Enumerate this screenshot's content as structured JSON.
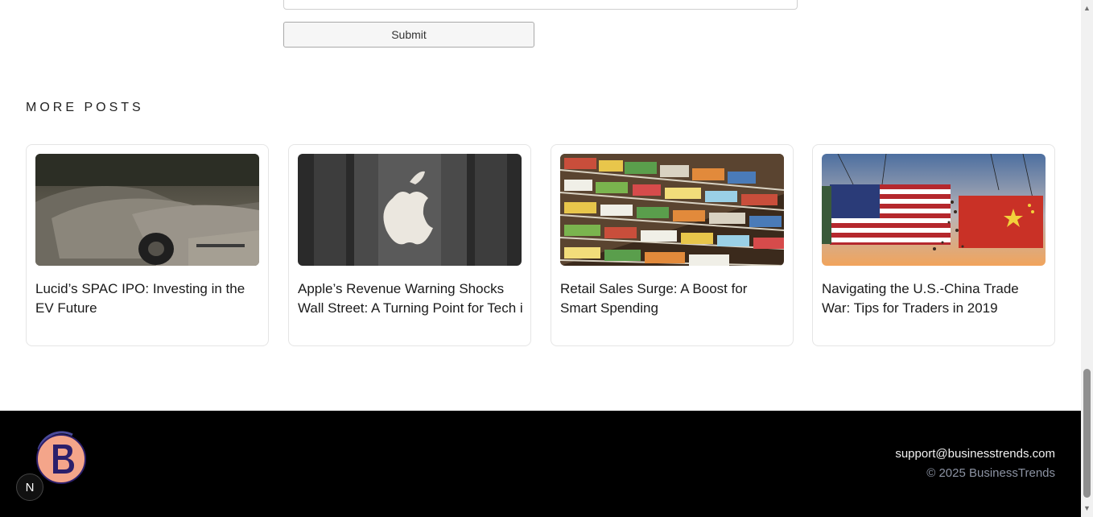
{
  "form": {
    "submit_label": "Submit"
  },
  "more_posts": {
    "title": "MORE POSTS",
    "posts": [
      {
        "title": "Lucid’s SPAC IPO: Investing in the EV Future",
        "image": "cars-photo"
      },
      {
        "title": "Apple’s Revenue Warning Shocks Wall Street: A Turning Point for Tech i",
        "image": "apple-logo-photo"
      },
      {
        "title": "Retail Sales Surge: A Boost for Smart Spending",
        "image": "supermarket-photo"
      },
      {
        "title": "Navigating the U.S.-China Trade War: Tips for Traders in 2019",
        "image": "containers-photo"
      }
    ]
  },
  "footer": {
    "email": "support@businesstrends.com",
    "copyright": "© 2025 BusinessTrends",
    "next_badge": "N"
  },
  "colors": {
    "footer_bg": "#000000",
    "logo_orange": "#f4a58a",
    "muted_text": "#8c93a3"
  }
}
